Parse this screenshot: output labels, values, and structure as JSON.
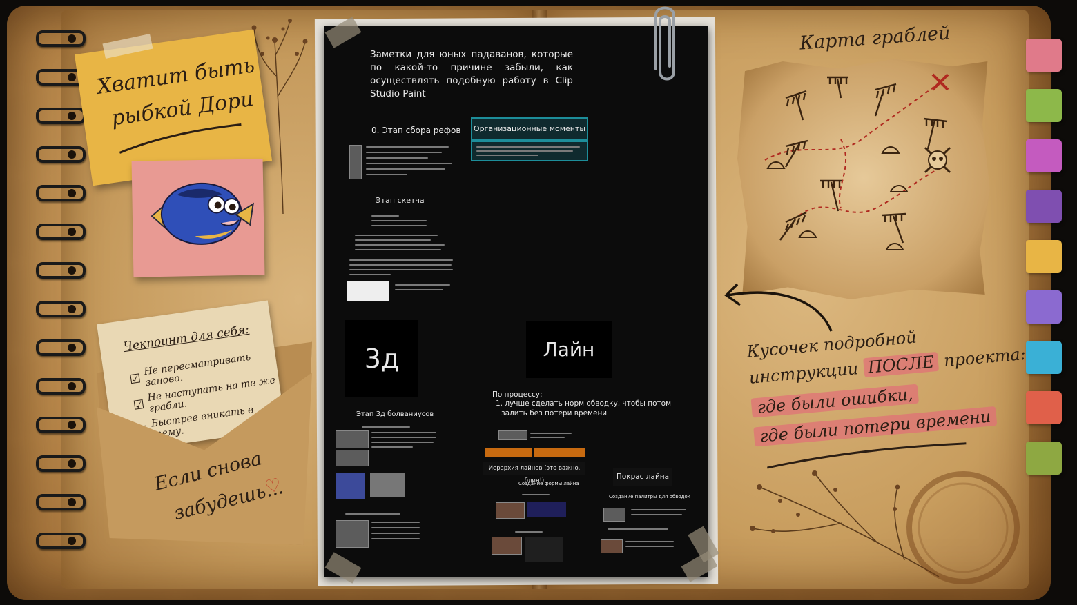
{
  "left_page": {
    "sticky_note": {
      "line1": "Хватит быть",
      "line2": "рыбкой Дори"
    },
    "checklist": {
      "title": "Чекпоинт для себя:",
      "items": [
        "Не пересматривать заново.",
        "Не наступать на те же грабли.",
        "Быстрее вникать в тему."
      ]
    },
    "envelope_text": {
      "line1": "Если снова",
      "line2": "забудешь..."
    }
  },
  "board": {
    "intro": "Заметки для юных падаванов, которые по какой-то причине забыли, как осуществлять подобную работу в Clip Studio Paint",
    "section_refs": "0. Этап сбора рефов",
    "org_box": "Организационные моменты",
    "section_sketch": "Этап скетча",
    "card_3d": "3д",
    "section_3d": "Этап 3д болваниусов",
    "card_line": "Лайн",
    "process_title": "По процессу:",
    "process_item_1": "1. лучше сделать норм обводку, чтобы потом",
    "process_item_2": "залить без потери времени",
    "hierarchy": "Иерархия лайнов (это важно, блин!)",
    "sub_form": "Создание формы лайна",
    "fill_line": "Покрас лайна",
    "sub_palette": "Создание палитры для обводок"
  },
  "right_page": {
    "map_title": "Карта граблей",
    "caption_line1": "Кусочек подробной",
    "caption_line2_a": "инструкции",
    "caption_line2_b": "ПОСЛЕ",
    "caption_line2_c": "проекта:",
    "caption_line3": "где были ошибки,",
    "caption_line4": "где были потери времени"
  },
  "colors": {
    "accent_teal": "#1d8e9a",
    "highlight_pink": "#e06e78",
    "tab_colors": [
      "#e07a8a",
      "#8db84a",
      "#c45bbf",
      "#7f4fb0",
      "#e8b545",
      "#8b6ad0",
      "#3ab0d6",
      "#e0604a",
      "#8ea842"
    ]
  },
  "icons": [
    "paperclip-icon",
    "arrow-left-icon",
    "heart-icon",
    "checkbox-icon",
    "skull-icon",
    "cross-icon",
    "rake-icon",
    "fish-illustration"
  ]
}
